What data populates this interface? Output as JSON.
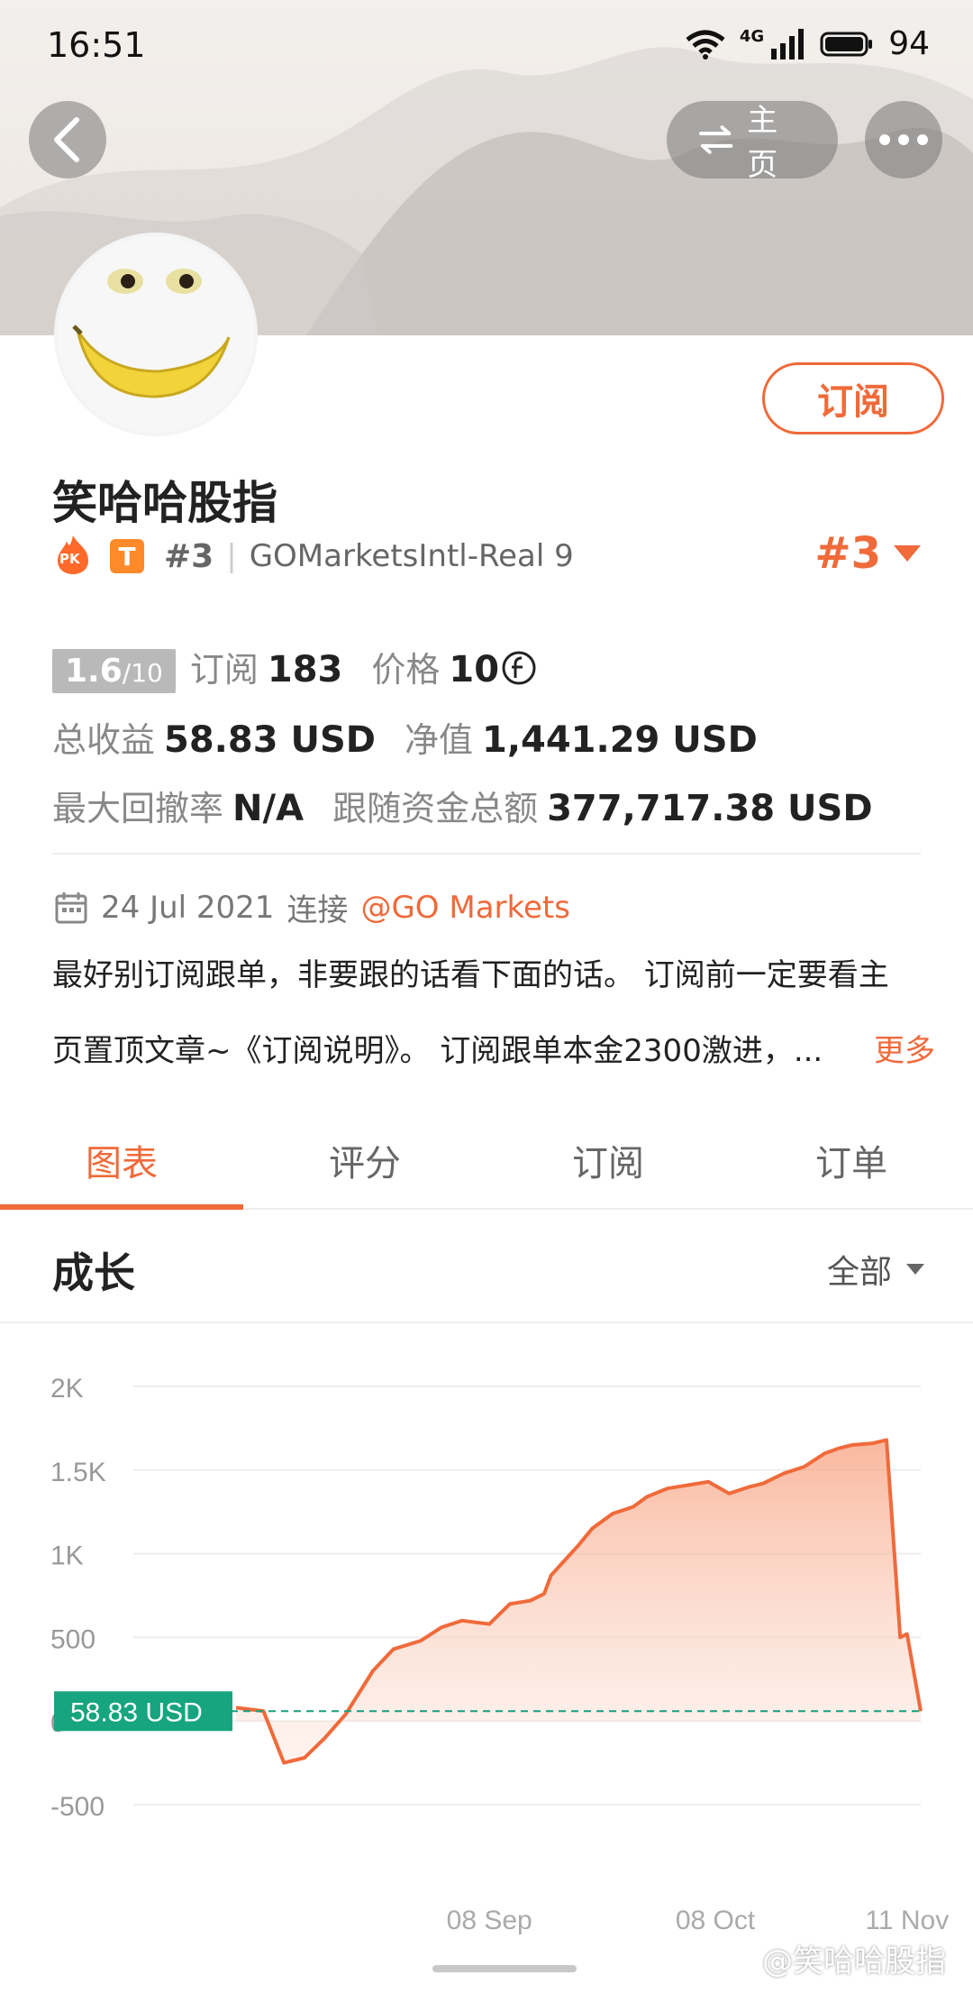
{
  "status_bar": {
    "time": "16:51",
    "network": "4G",
    "battery": "94"
  },
  "header": {
    "back_icon": "chevron-left-icon",
    "home_label": "主页",
    "more_icon": "more-horizontal-icon"
  },
  "profile": {
    "name": "笑哈哈股指",
    "subscribe_label": "订阅",
    "pk_badge": "PK",
    "tier_badge": "T",
    "rank_small": "#3",
    "broker": "GOMarketsIntl-Real 9",
    "rank_big": "#3"
  },
  "stats": {
    "score": "1.6",
    "score_total": "/10",
    "subscribe_label": "订阅",
    "subscribe_count": "183",
    "price_label": "价格",
    "price_value": "10",
    "total_profit_label": "总收益",
    "total_profit_value": "58.83 USD",
    "equity_label": "净值",
    "equity_value": "1,441.29 USD",
    "max_drawdown_label": "最大回撤率",
    "max_drawdown_value": "N/A",
    "follow_funds_label": "跟随资金总额",
    "follow_funds_value": "377,717.38 USD"
  },
  "connect": {
    "date": "24 Jul 2021",
    "connect_label": "连接",
    "broker_link": "@GO Markets"
  },
  "description": {
    "line1": "最好别订阅跟单，非要跟的话看下面的话。 订阅前一定要看主",
    "line2": "页置顶文章~《订阅说明》。 订阅跟单本金2300激进，...",
    "more_label": "更多"
  },
  "tabs": [
    {
      "label": "图表"
    },
    {
      "label": "评分"
    },
    {
      "label": "订阅"
    },
    {
      "label": "订单"
    }
  ],
  "section": {
    "title": "成长",
    "filter_label": "全部"
  },
  "chart_data": {
    "type": "area",
    "title": "",
    "ylabel": "",
    "ylim": [
      -500,
      2000
    ],
    "yticks": [
      "2K",
      "1.5K",
      "1K",
      "500",
      "0",
      "-500"
    ],
    "ytick_values": [
      2000,
      1500,
      1000,
      500,
      0,
      -500
    ],
    "xtick_labels": [
      "08 Sep",
      "08 Oct",
      "11 Nov"
    ],
    "xtick_positions": [
      0.37,
      0.7,
      0.98
    ],
    "current_value_label": "58.83 USD",
    "current_value": 58.83,
    "series": [
      {
        "x": [
          0.0,
          0.04,
          0.07,
          0.1,
          0.13,
          0.16,
          0.2,
          0.23,
          0.27,
          0.3,
          0.33,
          0.37,
          0.4,
          0.43,
          0.45,
          0.46,
          0.48,
          0.5,
          0.52,
          0.55,
          0.58,
          0.6,
          0.63,
          0.66,
          0.69,
          0.72,
          0.75,
          0.77,
          0.8,
          0.83,
          0.86,
          0.88,
          0.9,
          0.93,
          0.95,
          0.97,
          0.98,
          1.0
        ],
        "values": [
          80,
          60,
          -250,
          -220,
          -100,
          40,
          300,
          430,
          480,
          560,
          600,
          580,
          700,
          720,
          760,
          870,
          960,
          1050,
          1150,
          1240,
          1280,
          1340,
          1390,
          1410,
          1430,
          1360,
          1400,
          1420,
          1480,
          1520,
          1600,
          1630,
          1650,
          1660,
          1680,
          500,
          520,
          58.83
        ]
      }
    ]
  },
  "watermark": "@笑哈哈股指"
}
